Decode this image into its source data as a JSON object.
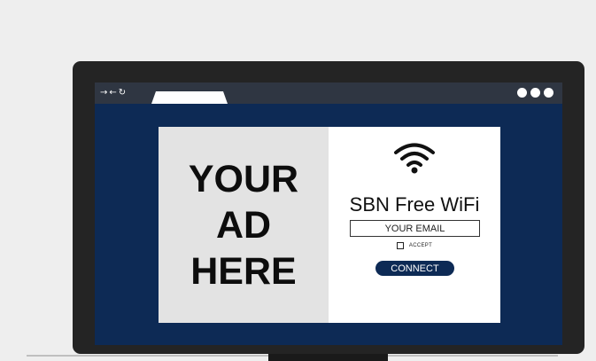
{
  "browser": {
    "nav_controls": {
      "forward": "→",
      "back": "←",
      "reload": "↻"
    },
    "window_controls": [
      "dot",
      "dot",
      "dot"
    ]
  },
  "ad": {
    "lines": [
      "YOUR",
      "AD",
      "HERE"
    ]
  },
  "login": {
    "icon": "wifi-icon",
    "network_name": "SBN Free WiFi",
    "email_placeholder": "YOUR EMAIL",
    "accept_label": "ACCEPT",
    "connect_label": "CONNECT"
  },
  "colors": {
    "screen_background": "#0d2a55",
    "button_background": "#0d2a55",
    "ad_background": "#e3e3e3",
    "monitor_bezel": "#242424"
  }
}
